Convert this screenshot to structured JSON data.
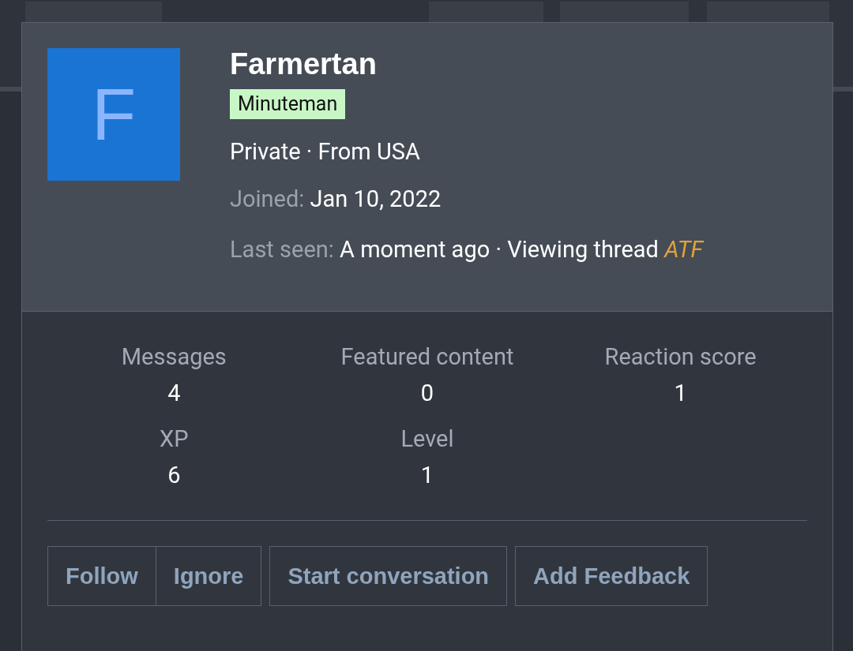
{
  "profile": {
    "avatar_letter": "F",
    "username": "Farmertan",
    "rank_badge": "Minuteman",
    "title_line": "Private · From USA",
    "joined": {
      "label": "Joined:",
      "value": "Jan 10, 2022"
    },
    "last_seen": {
      "label": "Last seen:",
      "value": "A moment ago · Viewing thread",
      "link": "ATF"
    }
  },
  "stats": [
    {
      "label": "Messages",
      "value": "4"
    },
    {
      "label": "Featured content",
      "value": "0"
    },
    {
      "label": "Reaction score",
      "value": "1"
    },
    {
      "label": "XP",
      "value": "6"
    },
    {
      "label": "Level",
      "value": "1"
    }
  ],
  "button_groups": [
    [
      "Follow",
      "Ignore"
    ],
    [
      "Start conversation"
    ],
    [
      "Add Feedback"
    ]
  ]
}
